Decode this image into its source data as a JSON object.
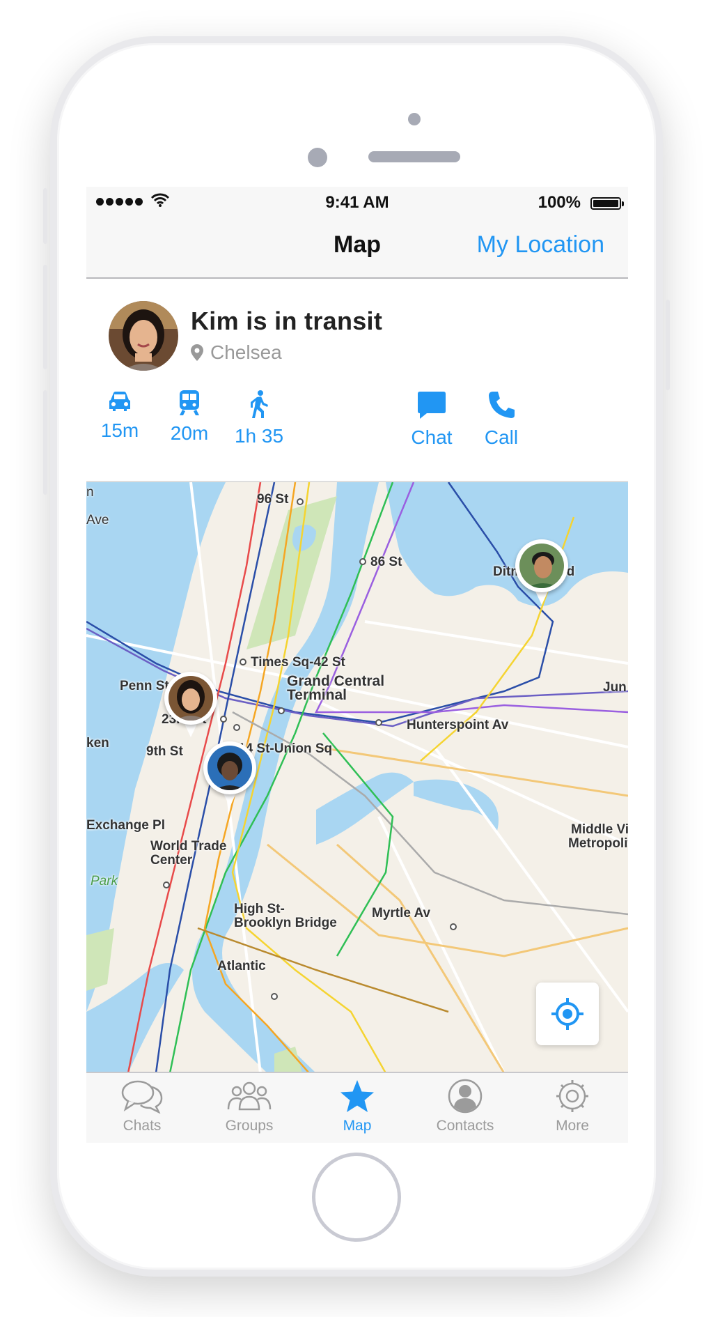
{
  "status_bar": {
    "time": "9:41 AM",
    "battery": "100%",
    "battery_level": 1.0
  },
  "nav": {
    "title": "Map",
    "action_label": "My Location"
  },
  "contact": {
    "name_status": "Kim is in transit",
    "location": "Chelsea",
    "actions": [
      {
        "icon": "car-icon",
        "label": "15m"
      },
      {
        "icon": "train-icon",
        "label": "20m"
      },
      {
        "icon": "walk-icon",
        "label": "1h 35"
      },
      {
        "icon": "chat-icon",
        "label": "Chat"
      },
      {
        "icon": "phone-icon",
        "label": "Call"
      }
    ]
  },
  "map": {
    "labels": {
      "l96": "96 St",
      "l86": "86 St",
      "ditmars": "Ditmars Blvd",
      "times": "Times Sq-42 St",
      "grand_central": "Grand Central Terminal",
      "grand": "Grand Central",
      "terminal": "Terminal",
      "penn": "Penn Station",
      "s23": "23rd St",
      "hunterspoint": "Hunterspoint Av",
      "union": "14 St-Union Sq",
      "s9": "9th St",
      "ken": "ken",
      "exchange": "Exchange Pl",
      "wtc1": "World Trade",
      "wtc2": "Center",
      "park": "Park",
      "highst1": "High St-",
      "highst2": "Brooklyn Bridge",
      "myrtle": "Myrtle Av",
      "atlantic": "Atlantic",
      "middle1": "Middle Village",
      "middle2": "Metropolitan",
      "jun": "Jun",
      "ave": "Ave",
      "n": "n"
    },
    "colors": {
      "water": "#a9d6f2",
      "land": "#f4f0e8",
      "park": "#cfe6b8"
    },
    "pins": [
      "person-pin-kim",
      "person-pin-woman",
      "person-pin-man"
    ]
  },
  "tabs": [
    {
      "icon": "chats-icon",
      "label": "Chats",
      "active": false
    },
    {
      "icon": "groups-icon",
      "label": "Groups",
      "active": false
    },
    {
      "icon": "star-icon",
      "label": "Map",
      "active": true
    },
    {
      "icon": "contacts-icon",
      "label": "Contacts",
      "active": false
    },
    {
      "icon": "gear-icon",
      "label": "More",
      "active": false
    }
  ],
  "accent_color": "#2196f3"
}
